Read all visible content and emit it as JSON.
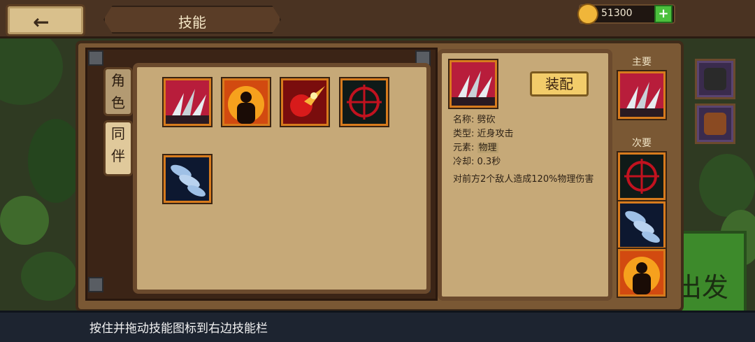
{
  "header": {
    "back_label": "←",
    "title": "技能",
    "coins": "51300",
    "add_label": "+"
  },
  "tabs": [
    {
      "label": "角色"
    },
    {
      "label": "同伴"
    }
  ],
  "skills_grid": [
    {
      "icon": "slash-claw-icon"
    },
    {
      "icon": "fire-aura-icon"
    },
    {
      "icon": "fireball-icon"
    },
    {
      "icon": "crosshair-icon"
    },
    {
      "icon": "bullets-icon"
    }
  ],
  "detail": {
    "icon": "slash-claw-icon",
    "equip_label": "装配",
    "name_label": "名称: ",
    "name_value": "劈砍",
    "type_label": "类型: ",
    "type_value": "近身攻击",
    "element_label": "元素: ",
    "element_value": "物理",
    "cooldown_label": "冷却: ",
    "cooldown_value": "0.3秒",
    "description": "对前方2个敌人造成120%物理伤害"
  },
  "equipped": {
    "primary_label": "主要",
    "secondary_label": "次要",
    "primary": [
      {
        "icon": "slash-claw-icon"
      }
    ],
    "secondary": [
      {
        "icon": "crosshair-icon"
      },
      {
        "icon": "bullets-icon"
      },
      {
        "icon": "fire-aura-icon"
      }
    ]
  },
  "side_buttons": [
    {
      "icon": "helmet-icon"
    },
    {
      "icon": "backpack-icon"
    }
  ],
  "background": {
    "depart_label": "出发"
  },
  "hint": "按住并拖动技能图标到右边技能栏"
}
